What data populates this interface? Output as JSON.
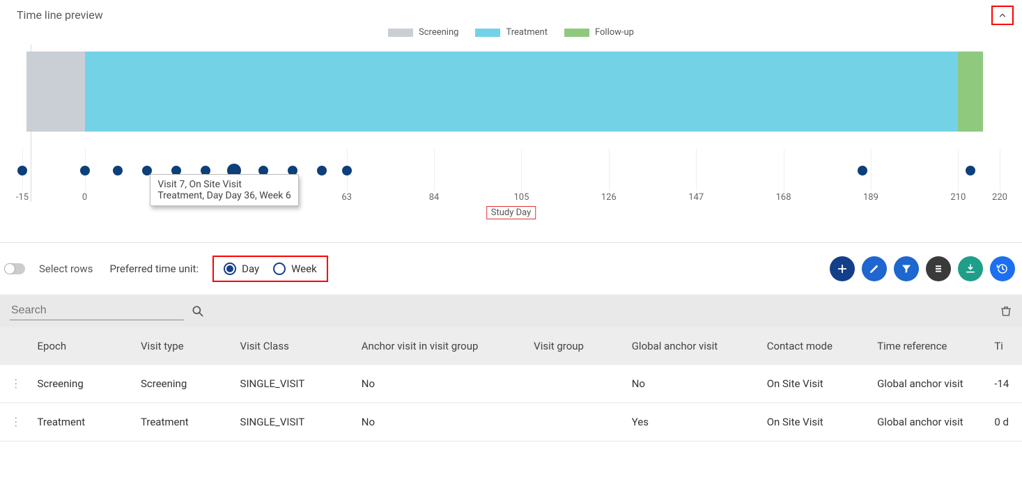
{
  "panel": {
    "title": "Time line preview"
  },
  "legend": {
    "screening": "Screening",
    "treatment": "Treatment",
    "follow_up": "Follow-up",
    "colors": {
      "screening": "#c9cfd4",
      "treatment": "#74d2e7",
      "follow_up": "#8fc97e"
    }
  },
  "tooltip": {
    "line1": "Visit 7, On Site Visit",
    "line2": "Treatment, Day Day 36, Week 6"
  },
  "xaxis": {
    "label": "Study Day",
    "ticks": [
      -15,
      0,
      63,
      84,
      105,
      126,
      147,
      168,
      189,
      210,
      220
    ]
  },
  "controls": {
    "select_rows": "Select rows",
    "preferred_unit": "Preferred time unit:",
    "day": "Day",
    "week": "Week",
    "selected": "day"
  },
  "search": {
    "placeholder": "Search"
  },
  "columns": {
    "epoch": "Epoch",
    "visit_type": "Visit type",
    "visit_class": "Visit Class",
    "anchor_in_group": "Anchor visit in visit group",
    "visit_group": "Visit group",
    "global_anchor": "Global anchor visit",
    "contact_mode": "Contact mode",
    "time_reference": "Time reference",
    "tim": "Ti"
  },
  "rows": [
    {
      "epoch": "Screening",
      "visit_type": "Screening",
      "visit_class": "SINGLE_VISIT",
      "anchor_in_group": "No",
      "visit_group": "",
      "global_anchor": "No",
      "contact_mode": "On Site Visit",
      "time_reference": "Global anchor visit",
      "tim": "-14"
    },
    {
      "epoch": "Treatment",
      "visit_type": "Treatment",
      "visit_class": "SINGLE_VISIT",
      "anchor_in_group": "No",
      "visit_group": "",
      "global_anchor": "Yes",
      "contact_mode": "On Site Visit",
      "time_reference": "Global anchor visit",
      "tim": "0 d"
    }
  ],
  "chart_data": {
    "type": "timeline",
    "title": "Time line preview",
    "xlabel": "Study Day",
    "xlim": [
      -15,
      220
    ],
    "series_bands": [
      {
        "name": "Screening",
        "color": "#c9cfd4",
        "start": -14,
        "end": 0
      },
      {
        "name": "Treatment",
        "color": "#74d2e7",
        "start": 0,
        "end": 210
      },
      {
        "name": "Follow-up",
        "color": "#8fc97e",
        "start": 210,
        "end": 216
      }
    ],
    "visit_points_x": [
      -15,
      0,
      8,
      15,
      22,
      29,
      36,
      43,
      50,
      57,
      63,
      187,
      213
    ],
    "highlighted_point_x": 36,
    "ticks": [
      -15,
      0,
      63,
      84,
      105,
      126,
      147,
      168,
      189,
      210,
      220
    ],
    "tooltip": {
      "x": 36,
      "lines": [
        "Visit 7, On Site Visit",
        "Treatment, Day Day 36, Week 6"
      ]
    }
  }
}
